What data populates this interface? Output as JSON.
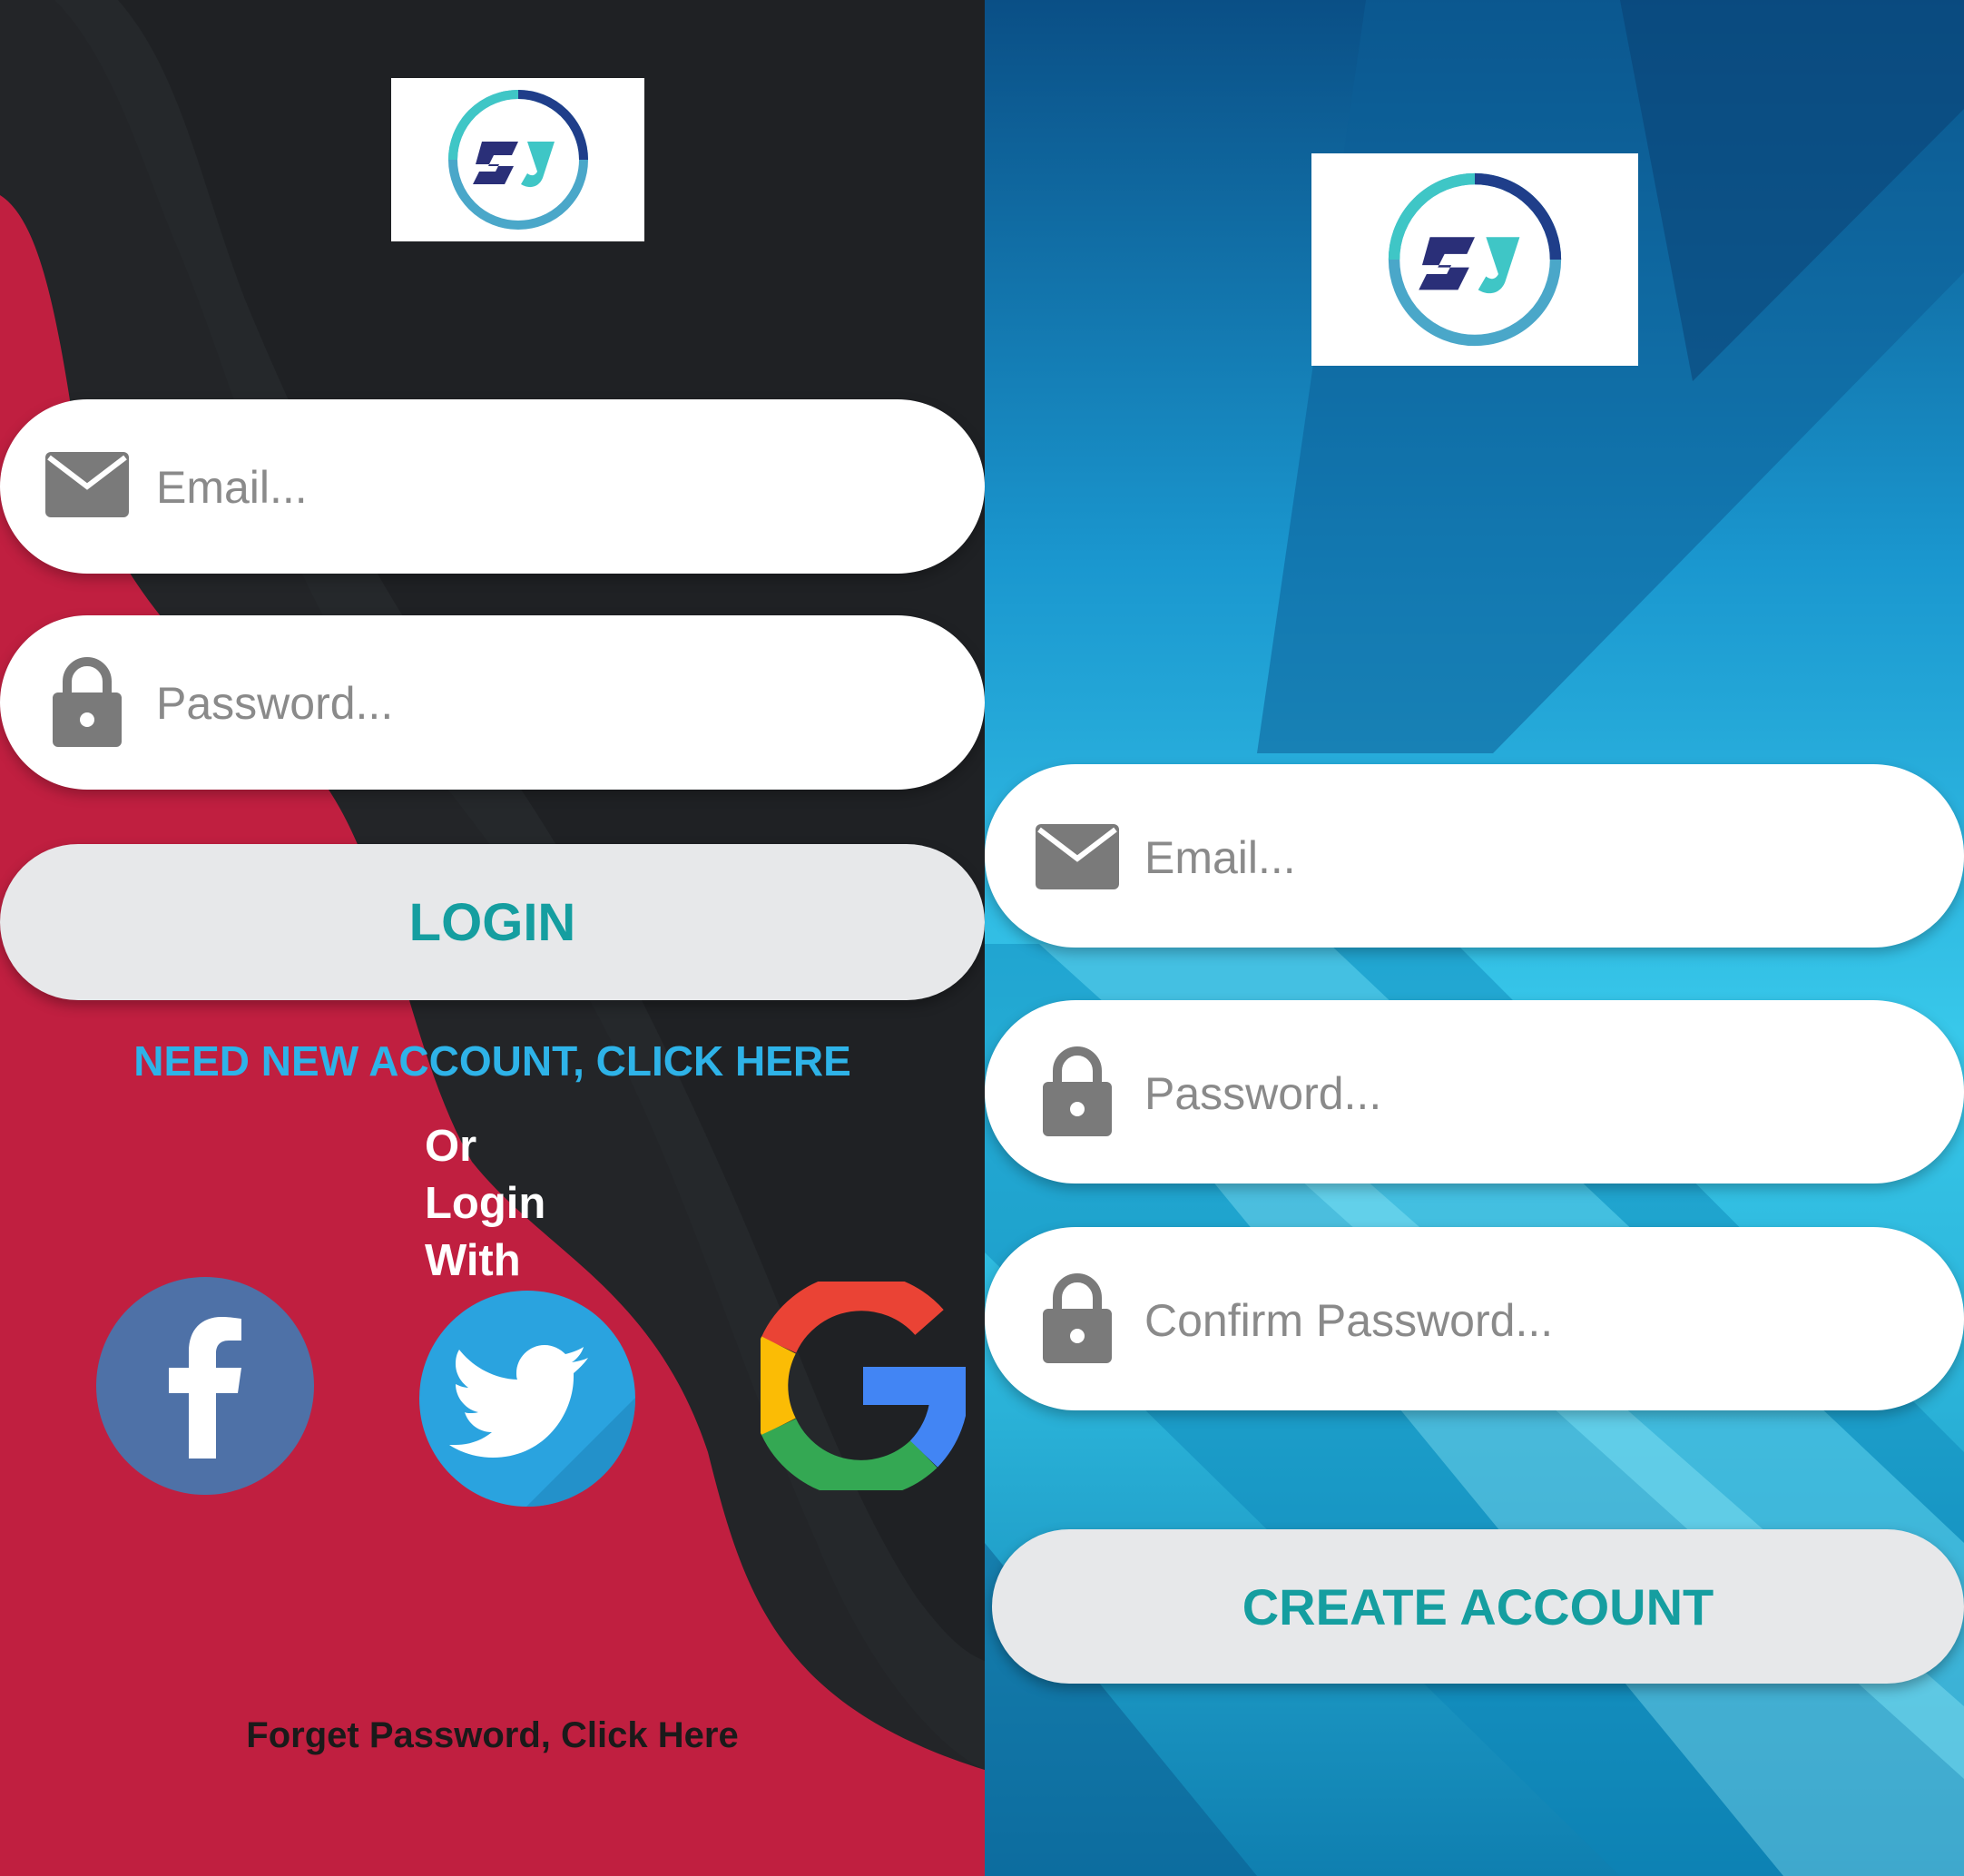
{
  "login": {
    "email_placeholder": "Email...",
    "password_placeholder": "Password...",
    "login_button": "LOGIN",
    "new_account_link": "NEED NEW ACCOUNT, CLICK HERE",
    "or_login_with": [
      "Or",
      "Login",
      "With"
    ],
    "social": [
      {
        "name": "facebook",
        "icon": "facebook-icon",
        "color": "#4e71a7"
      },
      {
        "name": "twitter",
        "icon": "twitter-icon",
        "color": "#2aa3df"
      },
      {
        "name": "google",
        "icon": "google-icon",
        "color": "#4285f4"
      }
    ],
    "forget_password_link": "Forget Password, Click Here"
  },
  "signup": {
    "email_placeholder": "Email...",
    "password_placeholder": "Password...",
    "confirm_password_placeholder": "Confirm Password...",
    "create_button": "CREATE ACCOUNT"
  },
  "colors": {
    "accent_teal": "#159ea0",
    "link_blue": "#2eb3e8",
    "crimson": "#c01f40",
    "dark": "#232528"
  },
  "icons": {
    "logo": "sj-logo",
    "email": "envelope-icon",
    "password": "lock-icon"
  }
}
